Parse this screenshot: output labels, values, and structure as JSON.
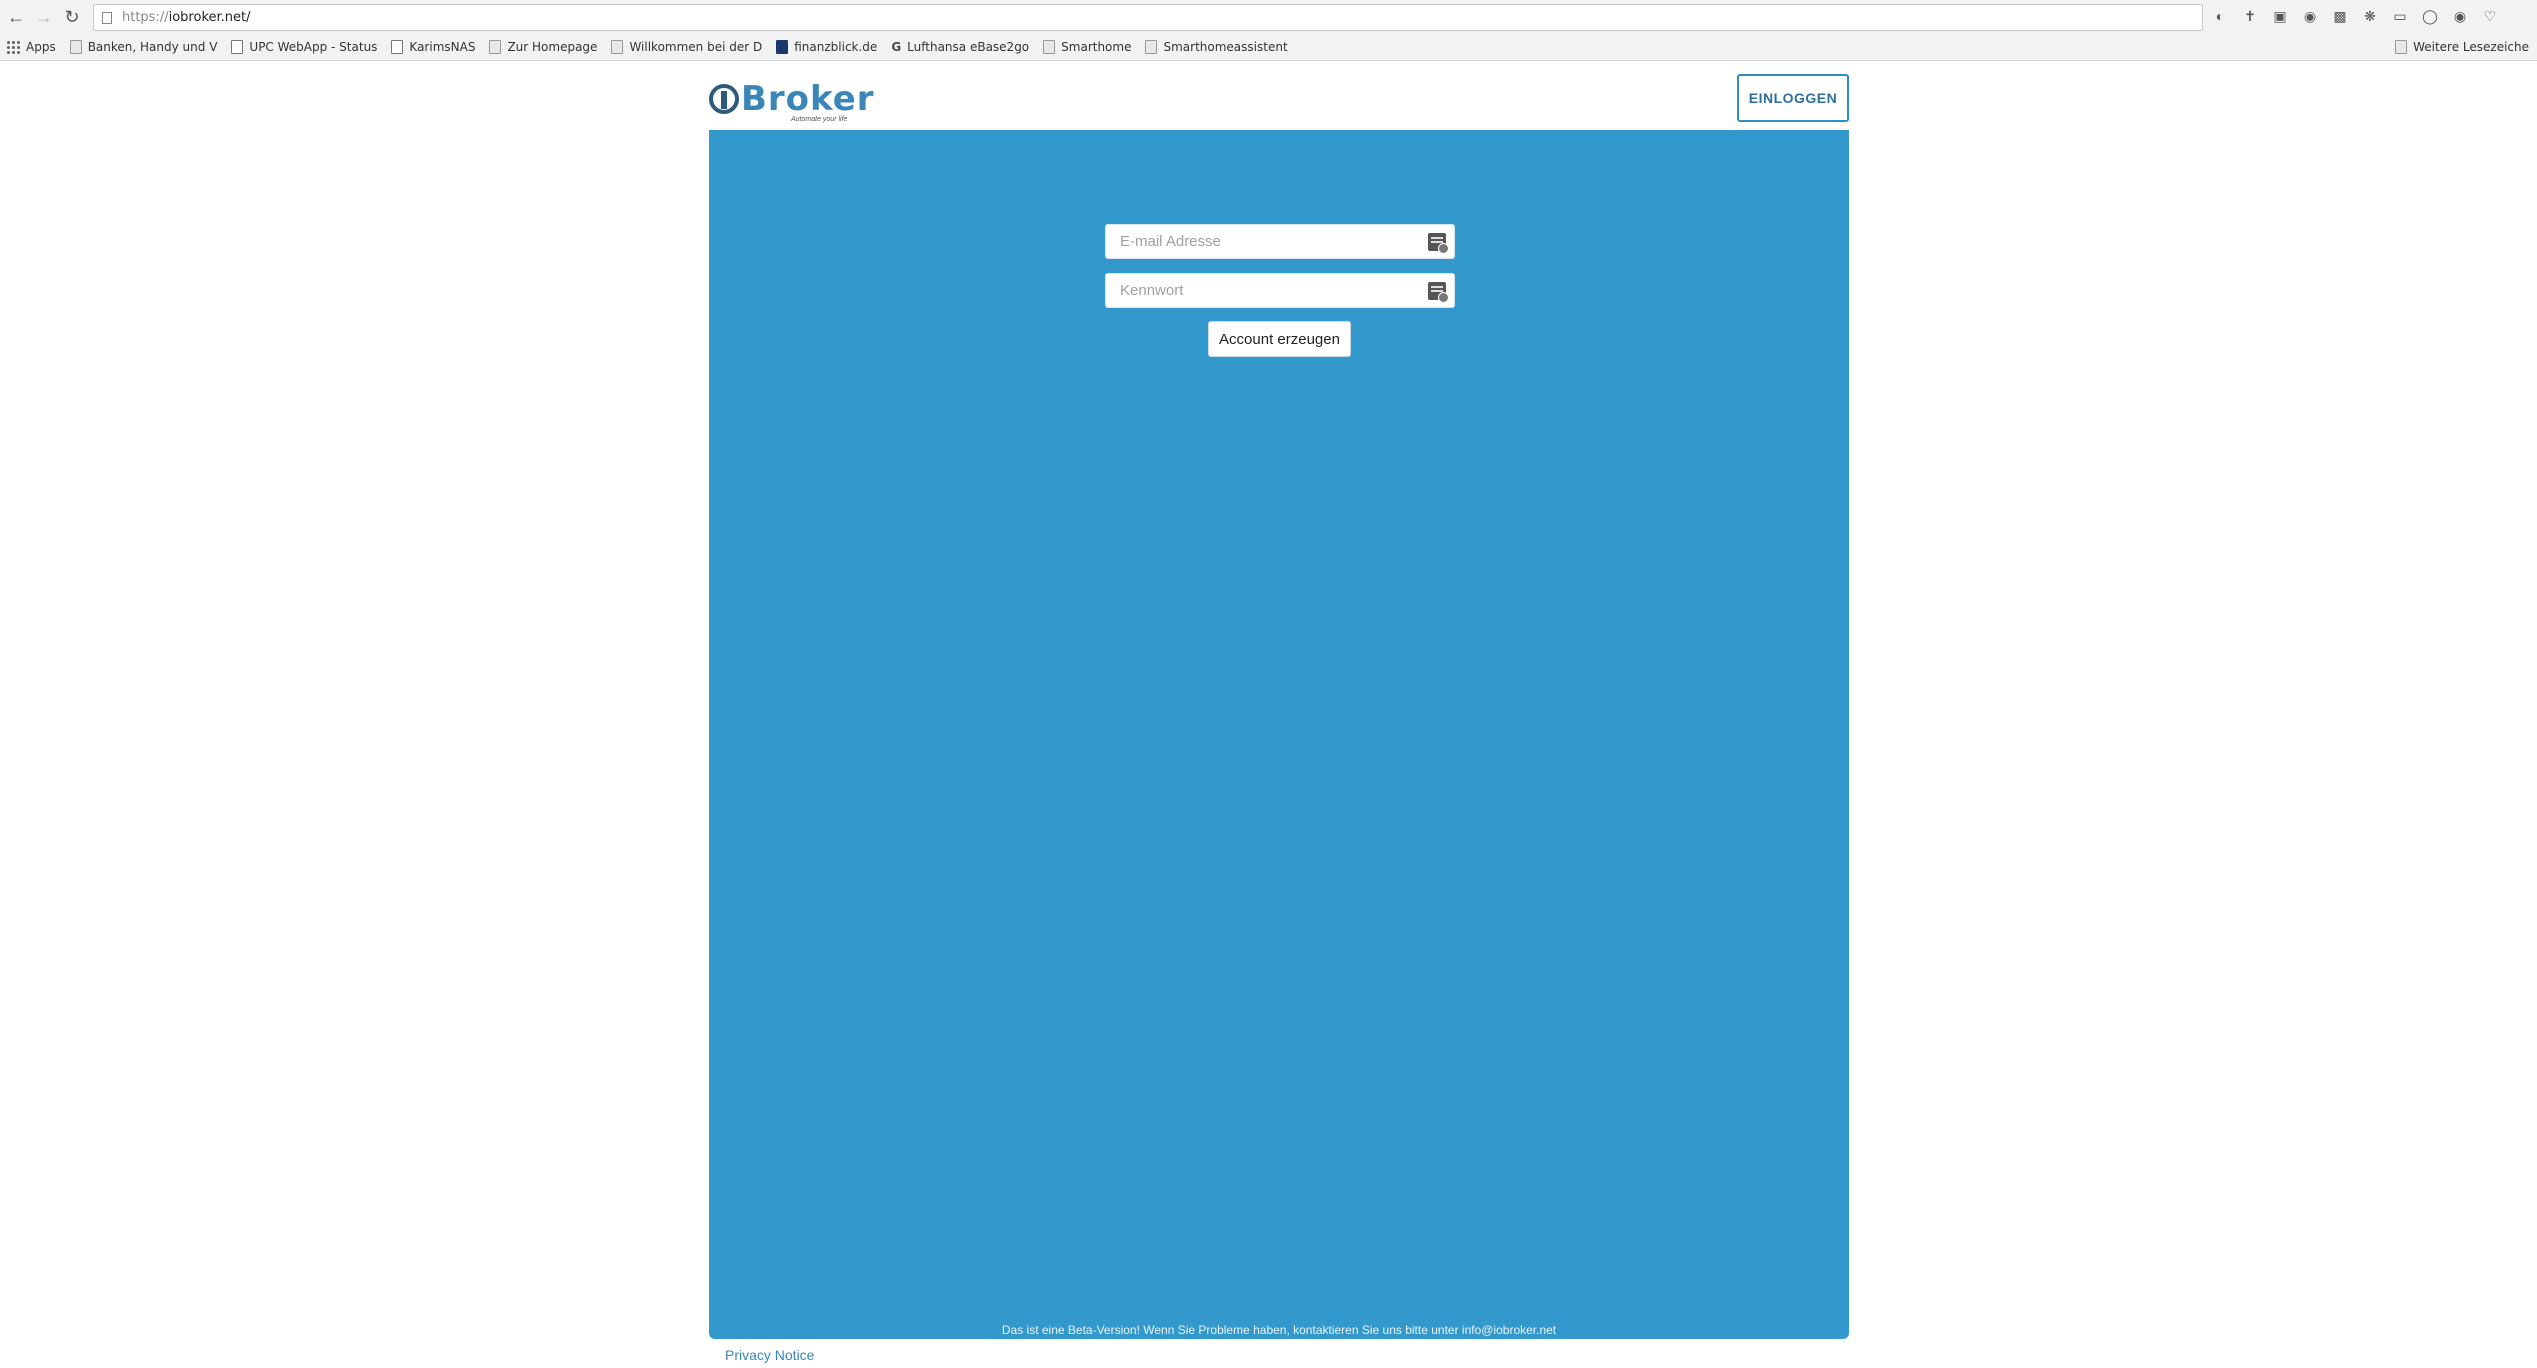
{
  "browser": {
    "url_protocol": "https://",
    "url_host": "iobroker.net/",
    "bookmarks": [
      {
        "label": "Apps",
        "icon": "apps-grid-icon"
      },
      {
        "label": "Banken, Handy und V",
        "icon": "folder-icon"
      },
      {
        "label": "UPC WebApp - Status",
        "icon": "page-icon"
      },
      {
        "label": "KarimsNAS",
        "icon": "page-icon"
      },
      {
        "label": "Zur Homepage",
        "icon": "nas-icon"
      },
      {
        "label": "Willkommen bei der D",
        "icon": "site-icon"
      },
      {
        "label": "finanzblick.de",
        "icon": "finanzblick-icon"
      },
      {
        "label": "Lufthansa eBase2go",
        "icon": "google-icon"
      },
      {
        "label": "Smarthome",
        "icon": "folder-icon"
      },
      {
        "label": "Smarthomeassistent",
        "icon": "folder-icon"
      }
    ],
    "other_bookmarks": "Weitere Lesezeiche"
  },
  "header": {
    "logo_text": "Broker",
    "tagline": "Automate your life",
    "login_label": "EINLOGGEN"
  },
  "form": {
    "email_placeholder": "E-mail Adresse",
    "password_placeholder": "Kennwort",
    "submit_label": "Account erzeugen"
  },
  "footer": {
    "beta_note": "Das ist eine Beta-Version! Wenn Sie Probleme haben, kontaktieren Sie uns bitte unter info@iobroker.net",
    "privacy_label": "Privacy Notice"
  },
  "colors": {
    "panel": "#3399cc",
    "accent": "#2e8fc4",
    "logo_blue": "#3a86b8"
  }
}
